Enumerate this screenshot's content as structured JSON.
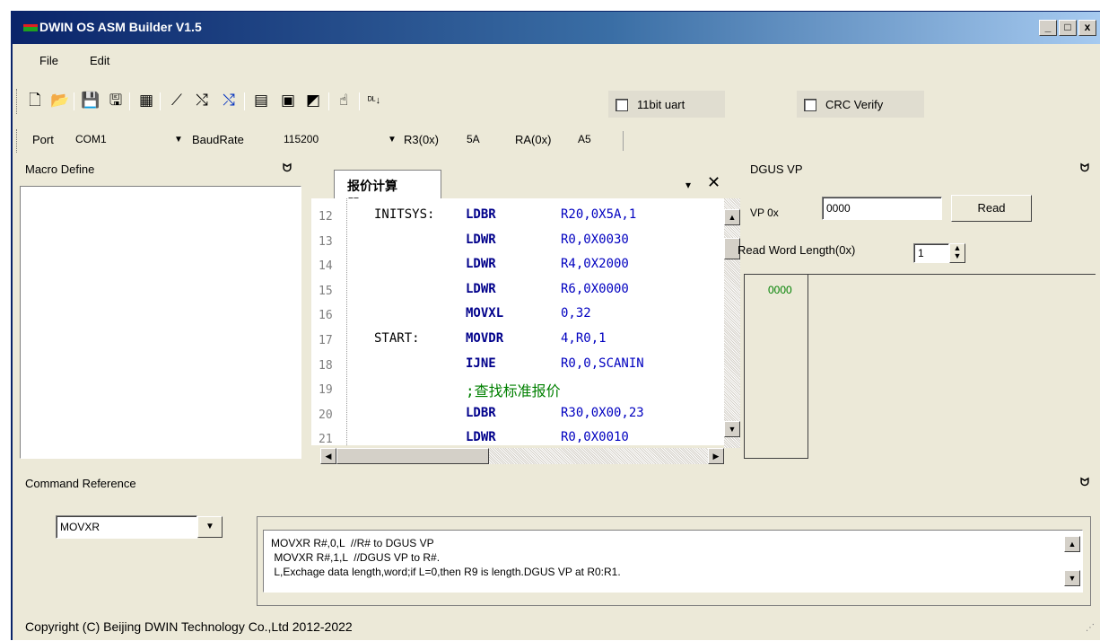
{
  "window": {
    "title": "DWIN OS ASM Builder V1.5",
    "controls": {
      "minimize": "_",
      "maximize": "□",
      "close": "x"
    }
  },
  "menu": {
    "file": "File",
    "edit": "Edit"
  },
  "toolbar": {
    "icons": [
      "new-icon",
      "open-icon",
      "save-icon",
      "save-all-icon",
      "build-icon",
      "compile-icon",
      "download-icon",
      "download-alt-icon",
      "debug-icon",
      "preview-icon",
      "properties-icon",
      "hand-icon",
      "download-dl-icon"
    ],
    "uart_label": "11bit uart",
    "crc_label": "CRC Verify"
  },
  "portbar": {
    "port_label": "Port",
    "port_value": "COM1",
    "baud_label": "BaudRate",
    "baud_value": "115200",
    "r3_label": "R3(0x)",
    "r3_value": "5A",
    "ra_label": "RA(0x)",
    "ra_value": "A5"
  },
  "macro_pane": {
    "title": "Macro Define",
    "pin": "P"
  },
  "editor": {
    "tab_label": "报价计算器.ASM",
    "lines": [
      {
        "n": "12",
        "label": "INITSYS:",
        "op": "LDBR",
        "args": "R20,0X5A,1"
      },
      {
        "n": "13",
        "label": "",
        "op": "LDWR",
        "args": "R0,0X0030"
      },
      {
        "n": "14",
        "label": "",
        "op": "LDWR",
        "args": "R4,0X2000"
      },
      {
        "n": "15",
        "label": "",
        "op": "LDWR",
        "args": "R6,0X0000"
      },
      {
        "n": "16",
        "label": "",
        "op": "MOVXL",
        "args": "0,32"
      },
      {
        "n": "17",
        "label": "START:",
        "op": "MOVDR",
        "args": "4,R0,1"
      },
      {
        "n": "18",
        "label": "",
        "op": "IJNE",
        "args": "R0,0,SCANIN"
      },
      {
        "n": "19",
        "label": "",
        "op": "",
        "args": "",
        "comment": ";查找标准报价"
      },
      {
        "n": "20",
        "label": "",
        "op": "LDBR",
        "args": "R30,0X00,23"
      },
      {
        "n": "21",
        "label": "",
        "op": "LDWR",
        "args": "R0,0X0010"
      }
    ]
  },
  "dgus_pane": {
    "title": "DGUS VP",
    "vp_label": "VP  0x",
    "vp_value": "0000",
    "read_button": "Read",
    "length_label": "Read Word Length(0x)",
    "length_value": "1",
    "result_value": "0000",
    "accent": "#008000"
  },
  "command_ref": {
    "title": "Command Reference",
    "selected": "MOVXR",
    "lines": [
      "MOVXR R#,0,L  //R# to DGUS VP",
      " MOVXR R#,1,L  //DGUS VP to R#.",
      " L,Exchage data length,word;if L=0,then R9 is length.DGUS VP at R0:R1."
    ]
  },
  "status": {
    "text": "Copyright (C) Beijing DWIN Technology Co.,Ltd 2012-2022"
  }
}
